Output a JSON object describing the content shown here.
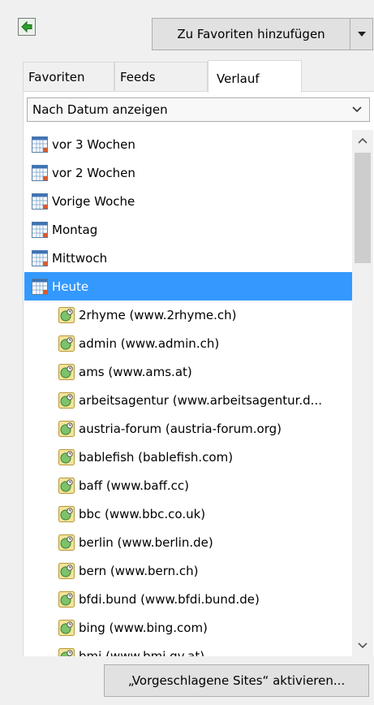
{
  "toolbar": {
    "add_favorite_label": "Zu Favoriten hinzufügen"
  },
  "tabs": [
    {
      "label": "Favoriten",
      "active": false
    },
    {
      "label": "Feeds",
      "active": false
    },
    {
      "label": "Verlauf",
      "active": true
    }
  ],
  "view_select": {
    "selected": "Nach Datum anzeigen"
  },
  "history": {
    "folders": [
      {
        "label": "vor 3 Wochen",
        "icon": "calendar-icon"
      },
      {
        "label": "vor 2 Wochen",
        "icon": "calendar-icon"
      },
      {
        "label": "Vorige Woche",
        "icon": "calendar-icon"
      },
      {
        "label": "Montag",
        "icon": "calendar-icon"
      },
      {
        "label": "Mittwoch",
        "icon": "calendar-icon"
      },
      {
        "label": "Heute",
        "icon": "calendar-icon",
        "selected": true
      }
    ],
    "sites": [
      {
        "label": "2rhyme (www.2rhyme.ch)"
      },
      {
        "label": "admin (www.admin.ch)"
      },
      {
        "label": "ams (www.ams.at)"
      },
      {
        "label": "arbeitsagentur (www.arbeitsagentur.d..."
      },
      {
        "label": "austria-forum (austria-forum.org)"
      },
      {
        "label": "bablefish (bablefish.com)"
      },
      {
        "label": "baff (www.baff.cc)"
      },
      {
        "label": "bbc (www.bbc.co.uk)"
      },
      {
        "label": "berlin (www.berlin.de)"
      },
      {
        "label": "bern (www.bern.ch)"
      },
      {
        "label": "bfdi.bund (www.bfdi.bund.de)"
      },
      {
        "label": "bing (www.bing.com)"
      },
      {
        "label": "bmi (www.bmi.gv.at)"
      }
    ]
  },
  "footer": {
    "suggested_sites_label": "„Vorgeschlagene Sites“ aktivieren..."
  },
  "colors": {
    "selection": "#3399ff",
    "panel_background": "#ffffff",
    "window_background": "#f0f0f0"
  }
}
